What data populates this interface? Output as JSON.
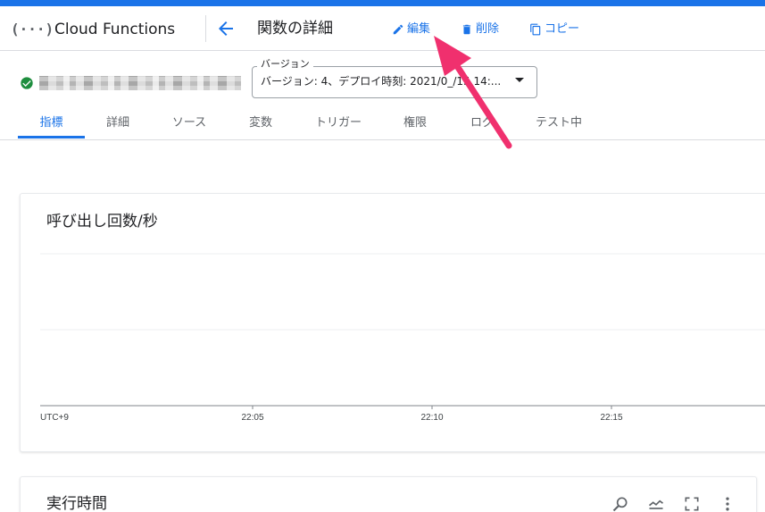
{
  "header": {
    "product_name": "Cloud Functions",
    "page_title": "関数の詳細",
    "actions": {
      "edit": "編集",
      "delete": "削除",
      "copy": "コピー"
    }
  },
  "function": {
    "status": "ok",
    "version_label": "バージョン",
    "version_value": "バージョン: 4、デプロイ時刻: 2021/0_/15 14:..."
  },
  "tabs": [
    {
      "label": "指標",
      "active": true
    },
    {
      "label": "詳細"
    },
    {
      "label": "ソース"
    },
    {
      "label": "変数"
    },
    {
      "label": "トリガー"
    },
    {
      "label": "権限"
    },
    {
      "label": "ログ"
    },
    {
      "label": "テスト中"
    }
  ],
  "cards": {
    "invocations_title": "呼び出し回数/秒",
    "execution_time_title": "実行時間"
  },
  "chart_data": {
    "type": "line",
    "title": "呼び出し回数/秒",
    "x_tick_labels": [
      "UTC+9",
      "22:05",
      "22:10",
      "22:15"
    ],
    "series": [],
    "grid": true
  },
  "colors": {
    "accent": "#1a73e8",
    "status_ok": "#1e8e3e",
    "annotation": "#f0306e"
  }
}
